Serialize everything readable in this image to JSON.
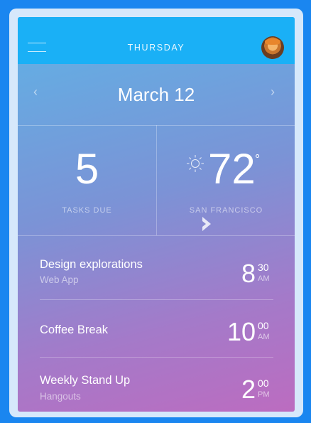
{
  "header": {
    "day": "THURSDAY"
  },
  "date_nav": {
    "date": "March 12",
    "prev_glyph": "‹",
    "next_glyph": "›"
  },
  "stats": {
    "tasks": {
      "value": "5",
      "label": "TASKS DUE"
    },
    "weather": {
      "temperature": "72",
      "unit": "°",
      "label": "SAN FRANCISCO",
      "icon": "sun-icon"
    }
  },
  "events": [
    {
      "title": "Design explorations",
      "subtitle": "Web App",
      "hour": "8",
      "minute": "30",
      "ampm": "AM"
    },
    {
      "title": "Coffee Break",
      "subtitle": "",
      "hour": "10",
      "minute": "00",
      "ampm": "AM"
    },
    {
      "title": "Weekly Stand Up",
      "subtitle": "Hangouts",
      "hour": "2",
      "minute": "00",
      "ampm": "PM"
    }
  ],
  "colors": {
    "background": "#1a86f0",
    "topbar": "#1ab0f6",
    "gradient_start": "#5fb3e6",
    "gradient_end": "#bc6cc0"
  }
}
